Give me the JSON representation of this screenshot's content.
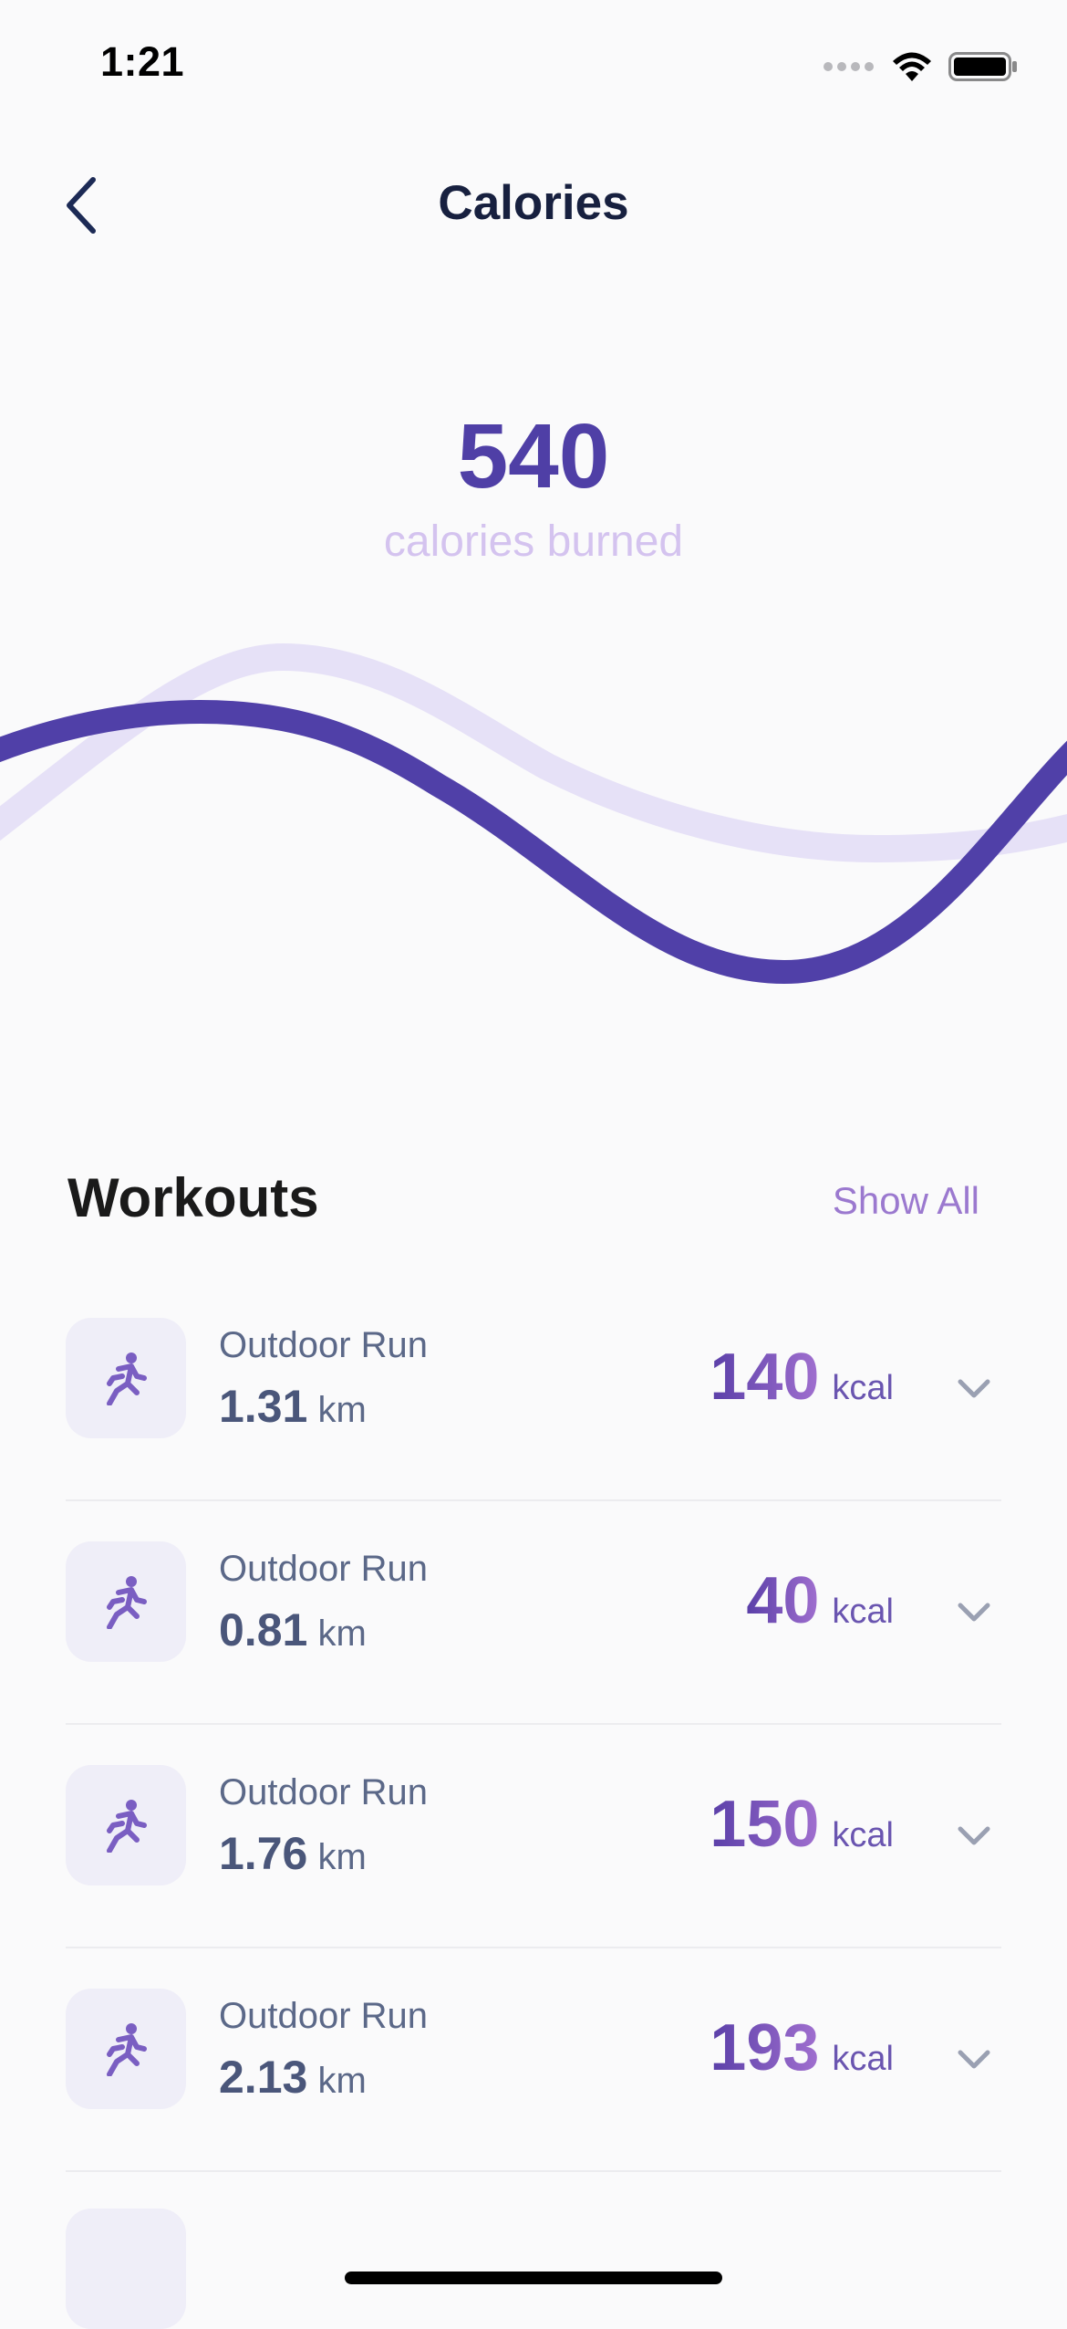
{
  "status_bar": {
    "time": "1:21"
  },
  "nav": {
    "title": "Calories"
  },
  "summary": {
    "value": "540",
    "label": "calories burned"
  },
  "workouts_section": {
    "title": "Workouts",
    "show_all_label": "Show All"
  },
  "workouts": [
    {
      "name": "Outdoor Run",
      "distance": "1.31",
      "distance_unit": "km",
      "calories": "140",
      "calories_unit": "kcal"
    },
    {
      "name": "Outdoor Run",
      "distance": "0.81",
      "distance_unit": "km",
      "calories": "40",
      "calories_unit": "kcal"
    },
    {
      "name": "Outdoor Run",
      "distance": "1.76",
      "distance_unit": "km",
      "calories": "150",
      "calories_unit": "kcal"
    },
    {
      "name": "Outdoor Run",
      "distance": "2.13",
      "distance_unit": "km",
      "calories": "193",
      "calories_unit": "kcal"
    }
  ],
  "icons": {
    "back": "chevron-left-icon",
    "workout": "running-icon",
    "expand": "chevron-down-icon"
  },
  "colors": {
    "accent": "#4f3fa6",
    "accent_light": "#d4c3ef",
    "link": "#9b79cf",
    "wave_primary": "#5040a8",
    "wave_secondary": "#e6e1f7"
  }
}
